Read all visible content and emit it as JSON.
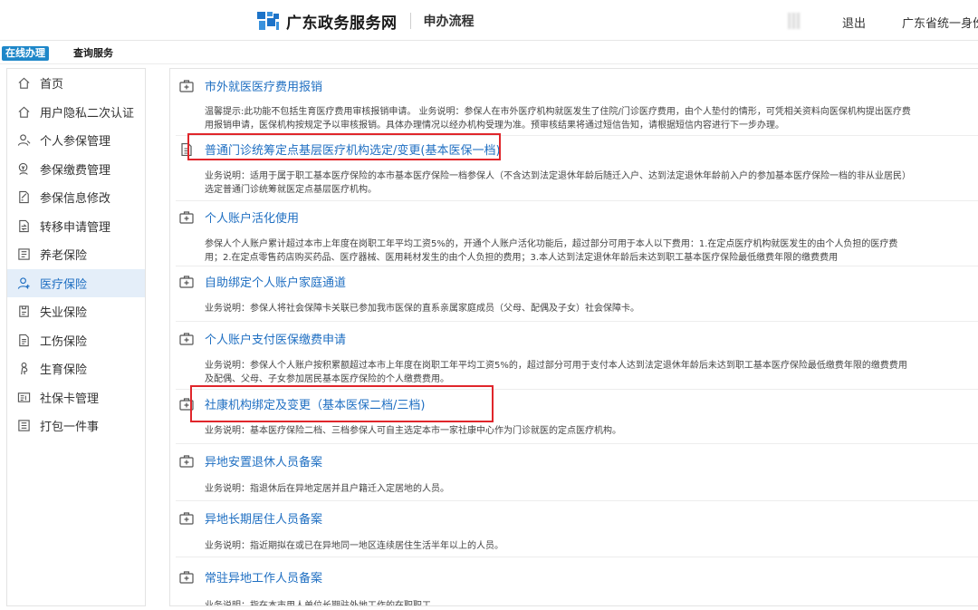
{
  "header": {
    "brand_name": "广东政务服务网",
    "sub_title": "申办流程",
    "logout": "退出",
    "account": "广东省统一身份"
  },
  "tabs": [
    {
      "label": "在线办理",
      "active": true
    },
    {
      "label": "查询服务",
      "active": false
    }
  ],
  "sidebar": {
    "items": [
      {
        "label": "首页",
        "icon": "home-icon",
        "active": false
      },
      {
        "label": "用户隐私二次认证",
        "icon": "home-icon",
        "active": false
      },
      {
        "label": "个人参保管理",
        "icon": "user-icon",
        "active": false
      },
      {
        "label": "参保缴费管理",
        "icon": "coin-user-icon",
        "active": false
      },
      {
        "label": "参保信息修改",
        "icon": "edit-document-icon",
        "active": false
      },
      {
        "label": "转移申请管理",
        "icon": "transfer-icon",
        "active": false
      },
      {
        "label": "养老保险",
        "icon": "pension-icon",
        "active": false
      },
      {
        "label": "医疗保险",
        "icon": "medical-user-icon",
        "active": true
      },
      {
        "label": "失业保险",
        "icon": "unemployment-icon",
        "active": false
      },
      {
        "label": "工伤保险",
        "icon": "injury-document-icon",
        "active": false
      },
      {
        "label": "生育保险",
        "icon": "maternity-icon",
        "active": false
      },
      {
        "label": "社保卡管理",
        "icon": "card-icon",
        "active": false
      },
      {
        "label": "打包一件事",
        "icon": "package-icon",
        "active": false
      }
    ]
  },
  "entries": [
    {
      "title": "市外就医医疗费用报销",
      "desc": [
        "温馨提示:此功能不包括生育医疗费用审核报销申请。 业务说明：参保人在市外医疗机构就医发生了住院/门诊医疗费用，由个人垫付的情形，可凭相关资料向医保机构提出医疗费",
        "用报销申请，医保机构按规定予以审核报销。具体办理情况以经办机构受理为准。预审核结果将通过短信告知，请根据短信内容进行下一步办理。"
      ],
      "highlighted": false
    },
    {
      "title": "普通门诊统筹定点基层医疗机构选定/变更(基本医保一档)",
      "desc": [
        "业务说明：适用于属于职工基本医疗保险的本市基本医疗保险一档参保人（不含达到法定退休年龄后随迁入户、达到法定退休年龄前入户的参加基本医疗保险一档的非从业居民）",
        "选定普通门诊统筹就医定点基层医疗机构。"
      ],
      "highlighted": true
    },
    {
      "title": "个人账户活化使用",
      "desc": [
        "参保人个人账户累计超过本市上年度在岗职工年平均工资5%的，开通个人账户活化功能后，超过部分可用于本人以下费用：1.在定点医疗机构就医发生的由个人负担的医疗费",
        "用；2.在定点零售药店购买药品、医疗器械、医用耗材发生的由个人负担的费用；3.本人达到法定退休年龄后未达到职工基本医疗保险最低缴费年限的缴费费用"
      ],
      "highlighted": false
    },
    {
      "title": "自助绑定个人账户家庭通道",
      "desc": [
        "业务说明：参保人将社会保障卡关联已参加我市医保的直系亲属家庭成员（父母、配偶及子女）社会保障卡。"
      ],
      "highlighted": false
    },
    {
      "title": "个人账户支付医保缴费申请",
      "desc": [
        "业务说明：参保人个人账户按积累额超过本市上年度在岗职工年平均工资5%的，超过部分可用于支付本人达到法定退休年龄后未达到职工基本医疗保险最低缴费年限的缴费费用",
        "及配偶、父母、子女参加居民基本医疗保险的个人缴费费用。"
      ],
      "highlighted": false
    },
    {
      "title": "社康机构绑定及变更（基本医保二档/三档)",
      "desc": [
        "业务说明：基本医疗保险二档、三档参保人可自主选定本市一家社康中心作为门诊就医的定点医疗机构。"
      ],
      "highlighted": true
    },
    {
      "title": "异地安置退休人员备案",
      "desc": [
        "业务说明：指退休后在异地定居并且户籍迁入定居地的人员。"
      ],
      "highlighted": false
    },
    {
      "title": "异地长期居住人员备案",
      "desc": [
        "业务说明：指近期拟在或已在异地同一地区连续居住生活半年以上的人员。"
      ],
      "highlighted": false
    },
    {
      "title": "常驻异地工作人员备案",
      "desc": [
        "业务说明：指在本市用人单位长期驻外地工作的在职职工。"
      ],
      "highlighted": false
    }
  ],
  "colors": {
    "link": "#1f6fc2",
    "tab_active": "#1e87c9",
    "sidebar_active_bg": "#e4eef9",
    "highlight_border": "#e0262b"
  }
}
